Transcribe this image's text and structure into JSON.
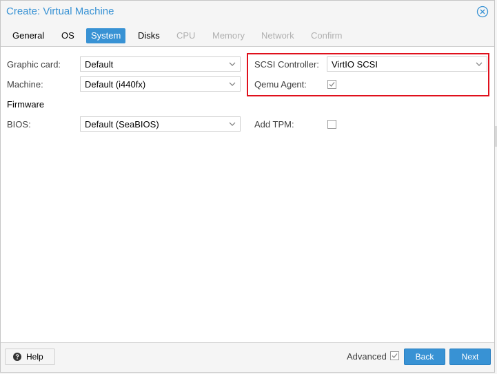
{
  "window": {
    "title": "Create: Virtual Machine"
  },
  "tabs": [
    {
      "label": "General",
      "state": "normal"
    },
    {
      "label": "OS",
      "state": "normal"
    },
    {
      "label": "System",
      "state": "active"
    },
    {
      "label": "Disks",
      "state": "normal"
    },
    {
      "label": "CPU",
      "state": "disabled"
    },
    {
      "label": "Memory",
      "state": "disabled"
    },
    {
      "label": "Network",
      "state": "disabled"
    },
    {
      "label": "Confirm",
      "state": "disabled"
    }
  ],
  "form": {
    "graphic_card": {
      "label": "Graphic card:",
      "value": "Default"
    },
    "machine": {
      "label": "Machine:",
      "value": "Default (i440fx)"
    },
    "firmware_heading": "Firmware",
    "bios": {
      "label": "BIOS:",
      "value": "Default (SeaBIOS)"
    },
    "scsi_controller": {
      "label": "SCSI Controller:",
      "value": "VirtIO SCSI"
    },
    "qemu_agent": {
      "label": "Qemu Agent:",
      "checked": true
    },
    "add_tpm": {
      "label": "Add TPM:",
      "checked": false
    }
  },
  "footer": {
    "help_label": "Help",
    "advanced_label": "Advanced",
    "advanced_checked": true,
    "back_label": "Back",
    "next_label": "Next"
  },
  "colors": {
    "accent": "#3892d4",
    "highlight_box": "#e0101c"
  },
  "icons": {
    "close": "close-circle-icon",
    "help": "question-circle-icon",
    "dropdown": "chevron-down-icon",
    "check": "checkmark-icon"
  }
}
